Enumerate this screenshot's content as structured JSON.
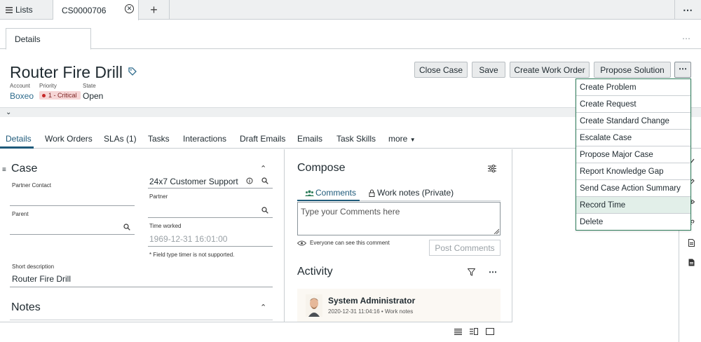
{
  "topbar": {
    "lists_label": "Lists",
    "case_tab_label": "CS0000706",
    "plus_label": "+",
    "more_label": "⋯"
  },
  "subtab": {
    "label": "Details",
    "more_label": "⋯"
  },
  "header": {
    "title": "Router Fire Drill",
    "account_label": "Account",
    "account_value": "Boxeo",
    "priority_label": "Priority",
    "priority_value": "1 - Critical",
    "state_label": "State",
    "state_value": "Open",
    "buttons": [
      "Close Case",
      "Save",
      "Create Work Order",
      "Propose Solution"
    ],
    "more_label": "⋯"
  },
  "section_tabs": {
    "items": [
      "Details",
      "Work Orders",
      "SLAs (1)",
      "Tasks",
      "Interactions",
      "Draft Emails",
      "Emails",
      "Task Skills",
      "more"
    ]
  },
  "case_form": {
    "section_title": "Case",
    "partner_contact_label": "Partner Contact",
    "support_value": "24x7 Customer Support",
    "partner_label": "Partner",
    "parent_label": "Parent",
    "time_worked_label": "Time worked",
    "time_worked_value": "1969-12-31 16:01:00",
    "timer_note": "* Field type timer is not supported.",
    "short_description_label": "Short description",
    "short_description_value": "Router Fire Drill",
    "notes_title": "Notes"
  },
  "compose": {
    "title": "Compose",
    "tab_comments": "Comments",
    "tab_worknotes": "Work notes (Private)",
    "textarea_placeholder": "Type your Comments here",
    "visibility_text": "Everyone can see this comment",
    "post_label": "Post Comments"
  },
  "activity": {
    "title": "Activity",
    "entries": [
      {
        "name": "System Administrator",
        "meta": "2020-12-31 11:04:16 • Work notes"
      }
    ]
  },
  "dropdown": {
    "items": [
      "Create Problem",
      "Create Request",
      "Create Standard Change",
      "Escalate Case",
      "Propose Major Case",
      "Report Knowledge Gap",
      "Send Case Action Summary",
      "Record Time",
      "Delete"
    ],
    "highlighted_index": 7
  },
  "colors": {
    "accent": "#1e5a7a",
    "dropdown_border": "#2e7d5b",
    "critical": "#c62828"
  }
}
